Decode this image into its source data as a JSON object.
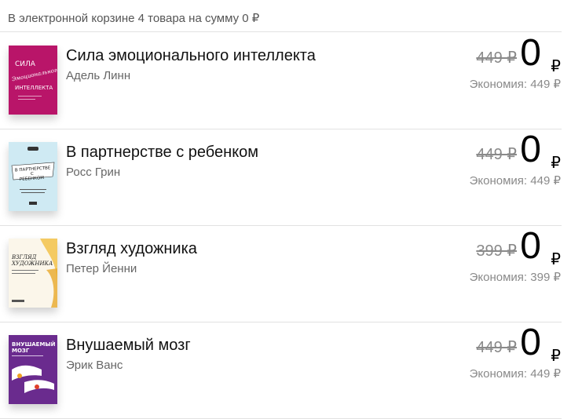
{
  "summary": {
    "text": "В электронной корзине 4 товара на сумму 0 ₽"
  },
  "items": [
    {
      "title": "Сила эмоционального интеллекта",
      "author": "Адель Линн",
      "old_price": "449 ₽",
      "new_price": "0",
      "currency": "₽",
      "savings": "Экономия: 449 ₽",
      "cover_lines": [
        "СИЛА",
        "Эмоционального",
        "ИНТЕЛЛЕКТА"
      ],
      "cover_color": "#c8186e"
    },
    {
      "title": "В партнерстве с ребенком",
      "author": "Росс Грин",
      "old_price": "449 ₽",
      "new_price": "0",
      "currency": "₽",
      "savings": "Экономия: 449 ₽",
      "cover_lines": [
        "В ПАРТНЕРСТВЕ",
        "С",
        "РЕБЕНКОМ"
      ],
      "cover_color": "#cfeaf3"
    },
    {
      "title": "Взгляд художника",
      "author": "Петер Йенни",
      "old_price": "399 ₽",
      "new_price": "0",
      "currency": "₽",
      "savings": "Экономия: 399 ₽",
      "cover_lines": [
        "ВЗГЛЯД",
        "ХУДОЖНИКА"
      ],
      "cover_color": "#fbf6ea"
    },
    {
      "title": "Внушаемый мозг",
      "author": "Эрик Ванс",
      "old_price": "449 ₽",
      "new_price": "0",
      "currency": "₽",
      "savings": "Экономия: 449 ₽",
      "cover_lines": [
        "ВНУШАЕМЫЙ",
        "МОЗГ"
      ],
      "cover_color": "#6a2b8e"
    }
  ]
}
